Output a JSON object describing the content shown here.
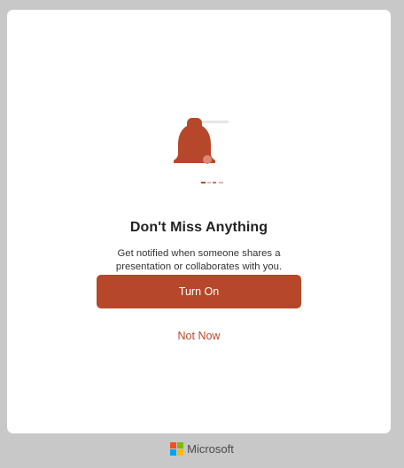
{
  "dialog": {
    "illustration_icon": "bell-icon",
    "title": "Don't Miss Anything",
    "message": "Get notified when someone shares a presentation or collaborates with you.",
    "primary_button_label": "Turn On",
    "secondary_button_label": "Not Now"
  },
  "footer": {
    "brand_name": "Microsoft",
    "logo_icon": "microsoft-logo-icon"
  },
  "colors": {
    "accent": "#b7472a",
    "background": "#c8c8c8",
    "card": "#ffffff",
    "logo_red": "#f25022",
    "logo_green": "#7fba00",
    "logo_blue": "#00a4ef",
    "logo_yellow": "#ffb900"
  }
}
